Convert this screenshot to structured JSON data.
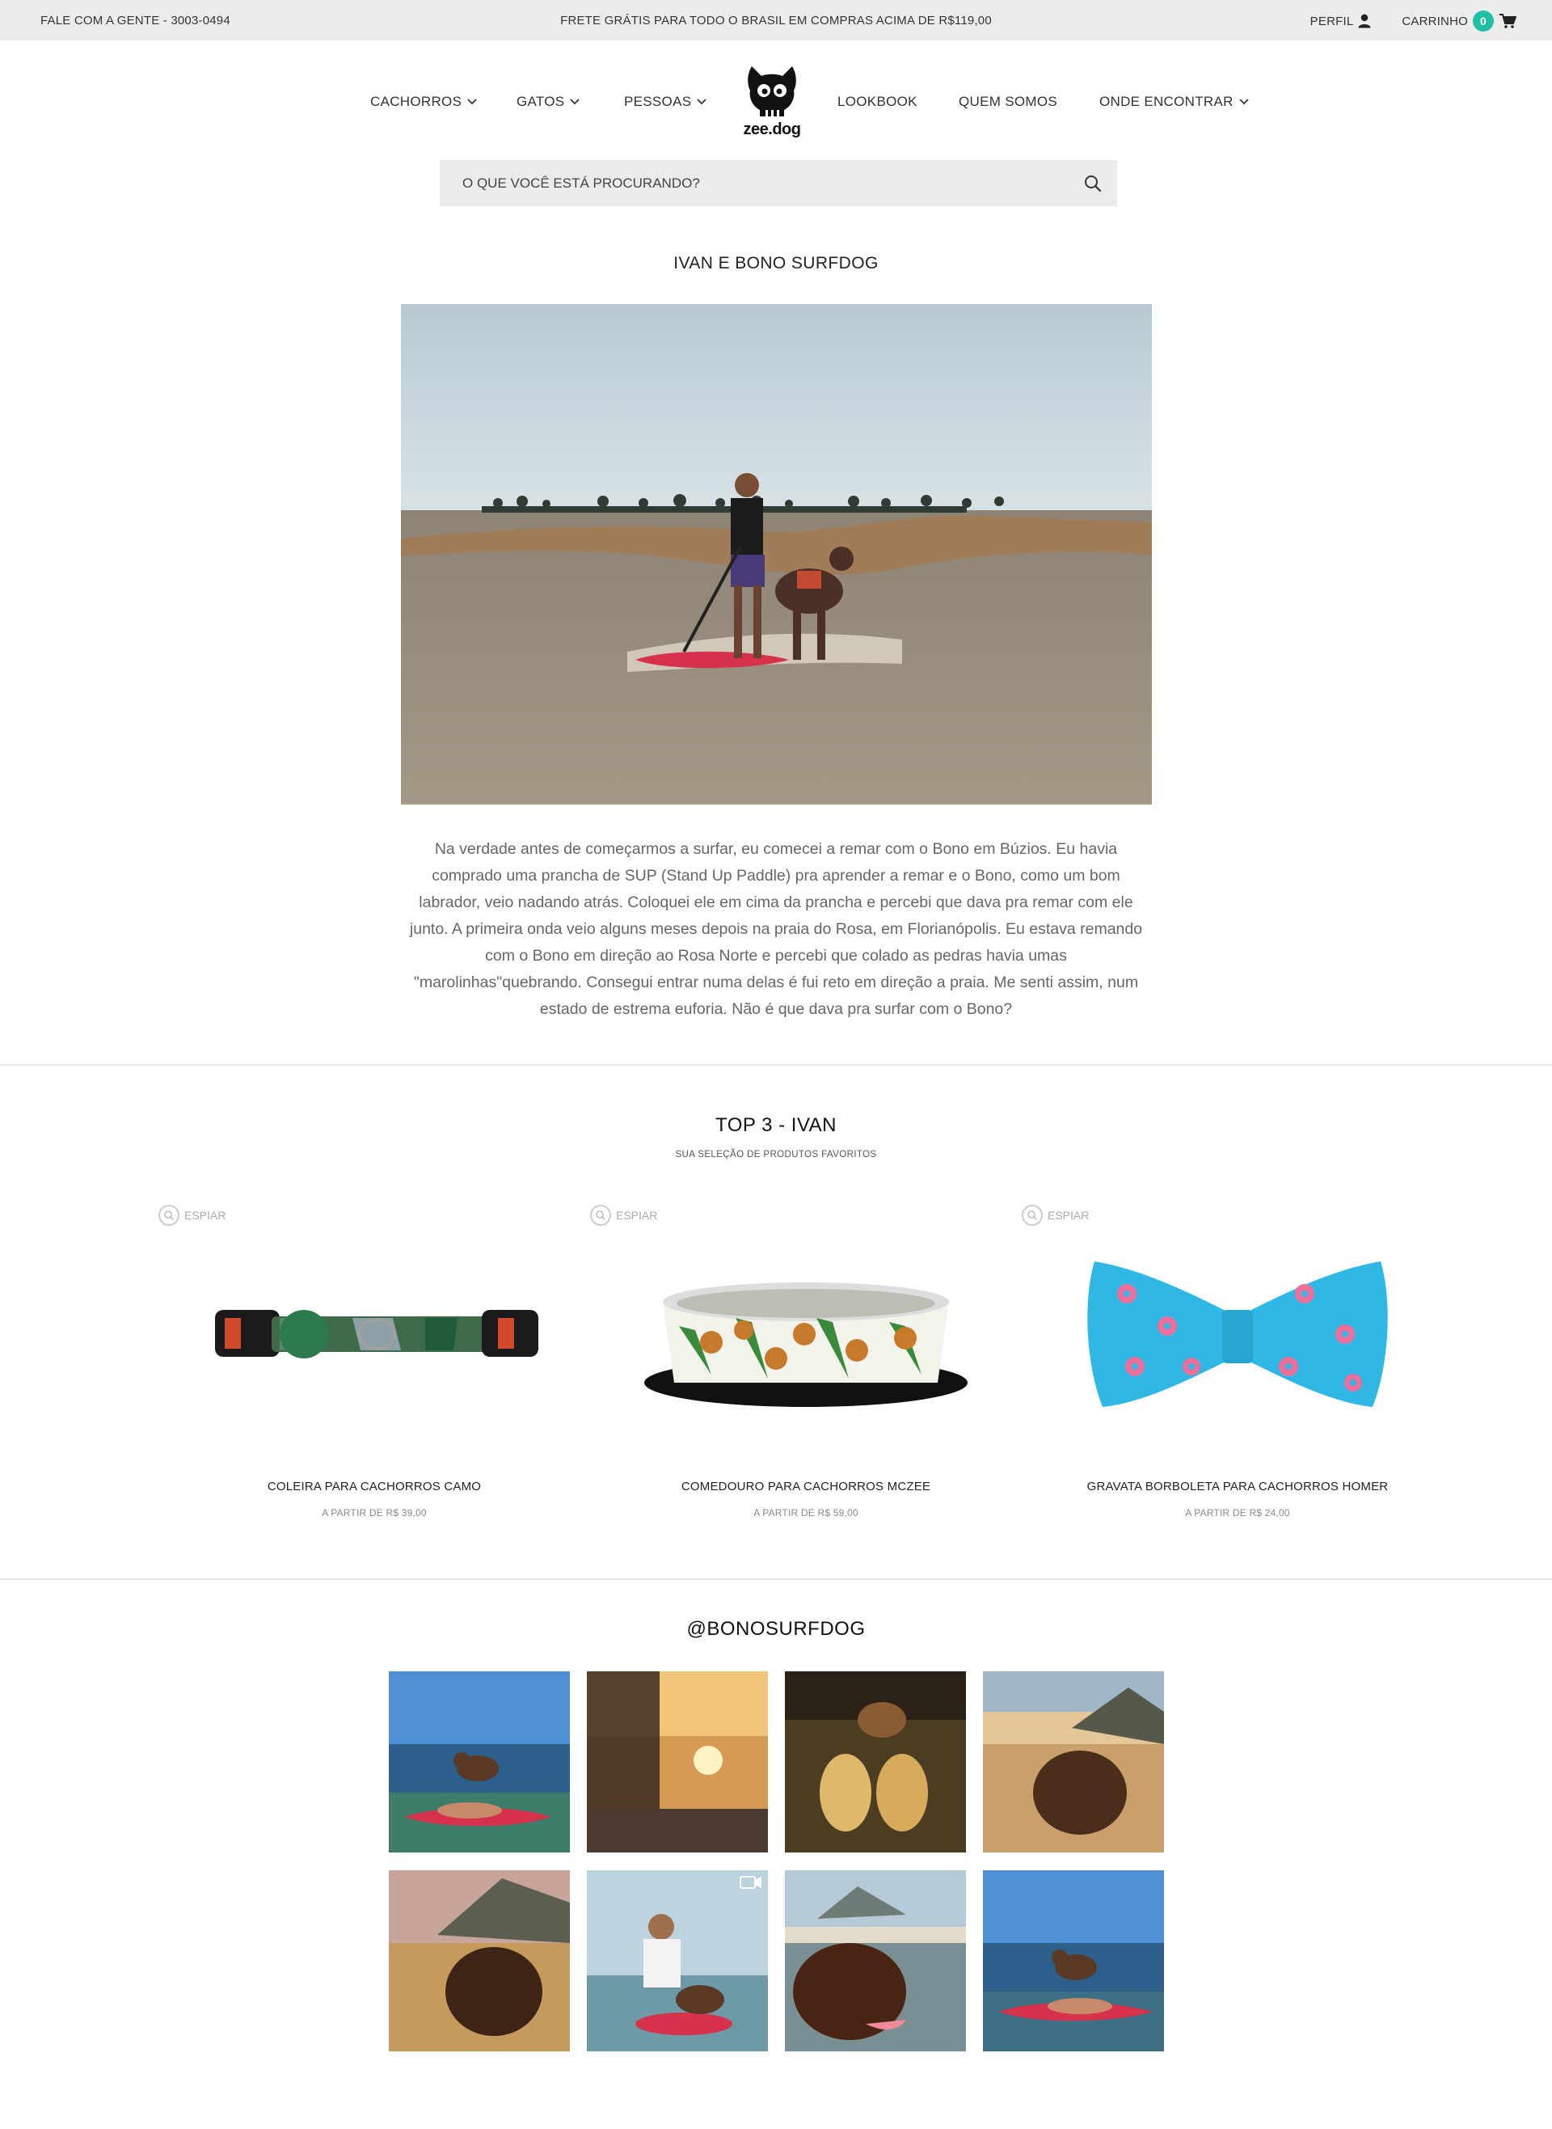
{
  "topbar": {
    "contact": "FALE COM A GENTE - 3003-0494",
    "promo": "FRETE GRÁTIS PARA TODO O BRASIL EM COMPRAS ACIMA DE R$119,00",
    "profile": "PERFIL",
    "cart": "CARRINHO",
    "cart_count": "0"
  },
  "nav": {
    "items": [
      {
        "label": "CACHORROS",
        "icon": "chevron-down-icon"
      },
      {
        "label": "GATOS",
        "icon": "chevron-down-icon"
      },
      {
        "label": "PESSOAS",
        "icon": "chevron-down-icon"
      },
      {
        "label": "LOOKBOOK"
      },
      {
        "label": "QUEM SOMOS"
      },
      {
        "label": "ONDE ENCONTRAR",
        "icon": "chevron-down-icon"
      }
    ],
    "logo_text": "zee.dog"
  },
  "search": {
    "placeholder": "O QUE VOCÊ ESTÁ PROCURANDO?",
    "icon": "search-icon"
  },
  "story": {
    "title": "IVAN E BONO SURFDOG",
    "text": "Na verdade antes de começarmos a surfar, eu comecei a remar com o Bono em Búzios. Eu havia comprado uma prancha de SUP (Stand Up Paddle) pra aprender a remar e o Bono, como um bom labrador, veio nadando atrás. Coloquei ele em cima da prancha e percebi que dava pra remar com ele junto. A primeira onda veio alguns meses depois na praia do Rosa, em Florianópolis. Eu estava remando com o Bono em direção ao Rosa Norte e percebi que colado as pedras havia umas \"marolinhas\"quebrando. Consegui entrar numa delas é fui reto em direção a praia. Me senti assim, num estado de estrema euforia. Não é que dava pra surfar com o Bono?"
  },
  "top3": {
    "title": "TOP 3 - IVAN",
    "subtitle": "SUA SELEÇÃO DE PRODUTOS FAVORITOS",
    "espiar": "ESPIAR",
    "products": [
      {
        "name": "COLEIRA PARA CACHORROS CAMO",
        "price": "A PARTIR DE R$ 39,00"
      },
      {
        "name": "COMEDOURO PARA CACHORROS MCZEE",
        "price": "A PARTIR DE R$ 59,00"
      },
      {
        "name": "GRAVATA BORBOLETA PARA CACHORROS HOMER",
        "price": "A PARTIR DE R$ 24,00"
      }
    ]
  },
  "instagram": {
    "handle": "@BONOSURFDOG"
  },
  "colors": {
    "accent": "#1fbfa4",
    "topbar_bg": "#ececec",
    "search_bg": "#ebebeb"
  }
}
